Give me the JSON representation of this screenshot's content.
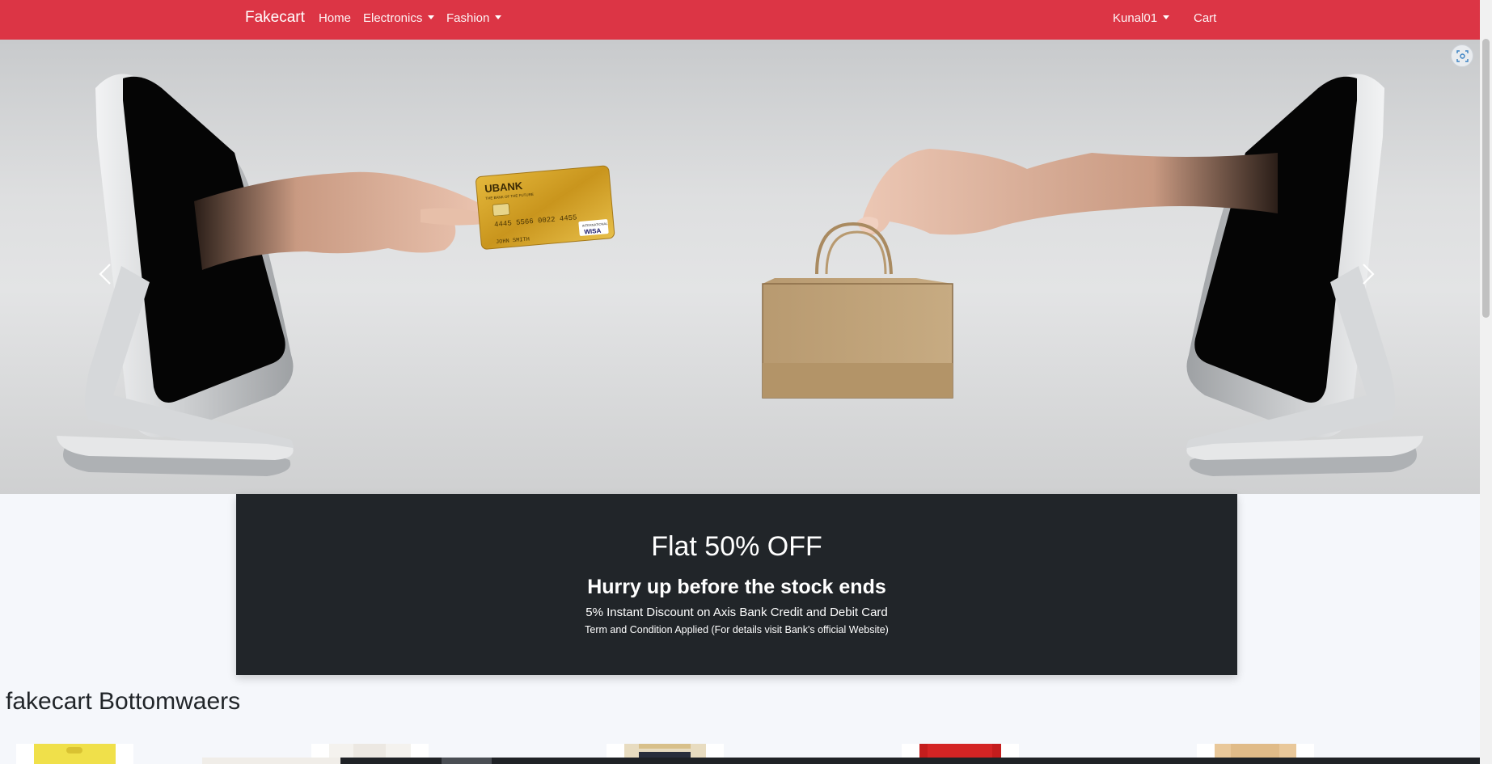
{
  "navbar": {
    "brand": "Fakecart",
    "links": {
      "home": "Home",
      "electronics": "Electronics",
      "fashion": "Fashion",
      "user": "Kunal01",
      "cart": "Cart"
    }
  },
  "carousel": {
    "card": {
      "bank": "UBANK",
      "tagline": "THE BANK OF THE FUTURE",
      "number": "4445 5566 0022 4455",
      "holder": "JOHN SMITH",
      "network": "WISA",
      "network_sub": "INTERNATIONAL"
    }
  },
  "offer": {
    "headline": "Flat 50% OFF",
    "subheadline": "Hurry up before the stock ends",
    "line1": "5% Instant Discount on Axis Bank Credit and Debit Card",
    "line2": "Term and Condition Applied (For details visit Bank's official Website)"
  },
  "section": {
    "title": "fakecart Bottomwaers"
  },
  "colors": {
    "navbar": "#dc3545",
    "offer_bg": "#212529",
    "page_bg": "#f5f7fb"
  }
}
